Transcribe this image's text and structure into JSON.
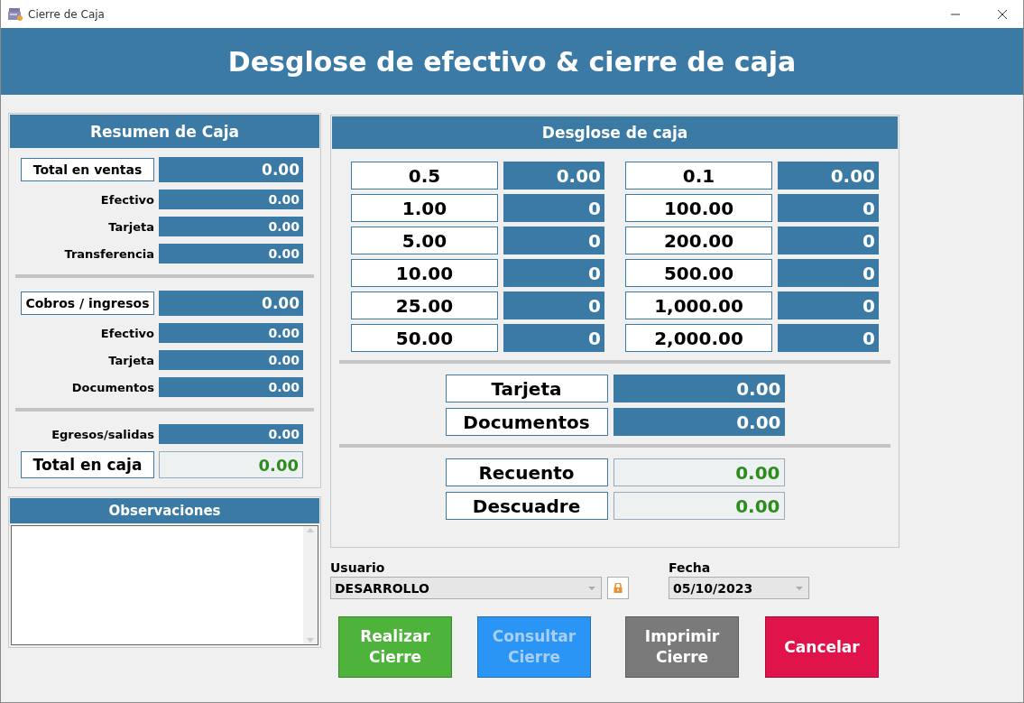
{
  "window": {
    "title": "Cierre de Caja"
  },
  "header": {
    "title": "Desglose de efectivo & cierre de caja"
  },
  "resumen": {
    "title": "Resumen de Caja",
    "rows": [
      {
        "kind": "boxed",
        "label": "Total en ventas",
        "value": "0.00"
      },
      {
        "kind": "plain",
        "label": "Efectivo",
        "value": "0.00"
      },
      {
        "kind": "plain",
        "label": "Tarjeta",
        "value": "0.00"
      },
      {
        "kind": "plain",
        "label": "Transferencia",
        "value": "0.00"
      },
      {
        "kind": "divider"
      },
      {
        "kind": "boxed",
        "label": "Cobros / ingresos",
        "value": "0.00"
      },
      {
        "kind": "plain",
        "label": "Efectivo",
        "value": "0.00"
      },
      {
        "kind": "plain",
        "label": "Tarjeta",
        "value": "0.00"
      },
      {
        "kind": "plain",
        "label": "Documentos",
        "value": "0.00"
      },
      {
        "kind": "divider"
      },
      {
        "kind": "plain",
        "label": "Egresos/salidas",
        "value": "0.00"
      },
      {
        "kind": "total",
        "label": "Total en caja",
        "value": "0.00"
      }
    ]
  },
  "observaciones": {
    "title": "Observaciones"
  },
  "desglose": {
    "title": "Desglose de caja",
    "columns": [
      [
        {
          "label": "0.5",
          "value": "0.00"
        },
        {
          "label": "1.00",
          "value": "0"
        },
        {
          "label": "5.00",
          "value": "0"
        },
        {
          "label": "10.00",
          "value": "0"
        },
        {
          "label": "25.00",
          "value": "0"
        },
        {
          "label": "50.00",
          "value": "0"
        }
      ],
      [
        {
          "label": "0.1",
          "value": "0.00"
        },
        {
          "label": "100.00",
          "value": "0"
        },
        {
          "label": "200.00",
          "value": "0"
        },
        {
          "label": "500.00",
          "value": "0"
        },
        {
          "label": "1,000.00",
          "value": "0"
        },
        {
          "label": "2,000.00",
          "value": "0"
        }
      ]
    ],
    "extras": [
      {
        "label": "Tarjeta",
        "value": "0.00"
      },
      {
        "label": "Documentos",
        "value": "0.00"
      }
    ],
    "results": [
      {
        "label": "Recuento",
        "value": "0.00"
      },
      {
        "label": "Descuadre",
        "value": "0.00"
      }
    ]
  },
  "usuario": {
    "label": "Usuario",
    "value": "DESARROLLO"
  },
  "fecha": {
    "label": "Fecha",
    "value": "05/10/2023"
  },
  "buttons": [
    {
      "label": "Realizar Cierre",
      "color": "#4db33a",
      "disabled": false
    },
    {
      "label": "Consultar Cierre",
      "color": "#2b95f5",
      "disabled": true
    },
    {
      "label": "Imprimir Cierre",
      "color": "#7a7a7a",
      "disabled": false
    },
    {
      "label": "Cancelar",
      "color": "#e0134a",
      "disabled": false
    }
  ]
}
